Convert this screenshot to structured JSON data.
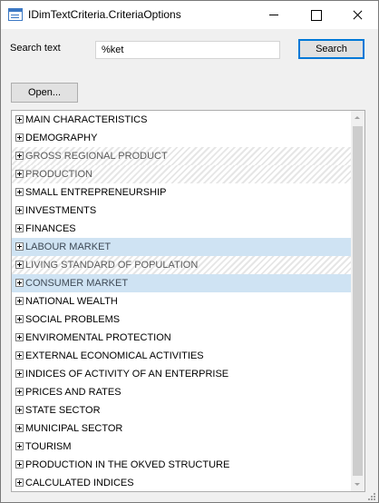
{
  "window": {
    "title": "IDimTextCriteria.CriteriaOptions"
  },
  "search": {
    "label": "Search text",
    "value": "%ket",
    "button_label": "Search"
  },
  "open_button_label": "Open...",
  "tree": {
    "items": [
      {
        "label": "MAIN CHARACTERISTICS",
        "state": "normal"
      },
      {
        "label": "DEMOGRAPHY",
        "state": "normal"
      },
      {
        "label": "GROSS REGIONAL PRODUCT",
        "state": "hatched"
      },
      {
        "label": "PRODUCTION",
        "state": "hatched"
      },
      {
        "label": "SMALL ENTREPRENEURSHIP",
        "state": "normal"
      },
      {
        "label": "INVESTMENTS",
        "state": "normal"
      },
      {
        "label": "FINANCES",
        "state": "normal"
      },
      {
        "label": "LABOUR MARKET",
        "state": "selected"
      },
      {
        "label": "LIVING STANDARD OF POPULATION",
        "state": "hatched"
      },
      {
        "label": "CONSUMER MARKET",
        "state": "selected"
      },
      {
        "label": "NATIONAL WEALTH",
        "state": "normal"
      },
      {
        "label": "SOCIAL PROBLEMS",
        "state": "normal"
      },
      {
        "label": "ENVIROMENTAL PROTECTION",
        "state": "normal"
      },
      {
        "label": "EXTERNAL ECONOMICAL ACTIVITIES",
        "state": "normal"
      },
      {
        "label": "INDICES OF ACTIVITY OF AN ENTERPRISE",
        "state": "normal"
      },
      {
        "label": "PRICES AND RATES",
        "state": "normal"
      },
      {
        "label": "STATE SECTOR",
        "state": "normal"
      },
      {
        "label": "MUNICIPAL SECTOR",
        "state": "normal"
      },
      {
        "label": "TOURISM",
        "state": "normal"
      },
      {
        "label": "PRODUCTION IN THE OKVED STRUCTURE",
        "state": "normal"
      },
      {
        "label": "CALCULATED INDICES",
        "state": "normal"
      }
    ]
  },
  "colors": {
    "selection_background": "#cfe3f3",
    "focus_border": "#0078d7"
  }
}
